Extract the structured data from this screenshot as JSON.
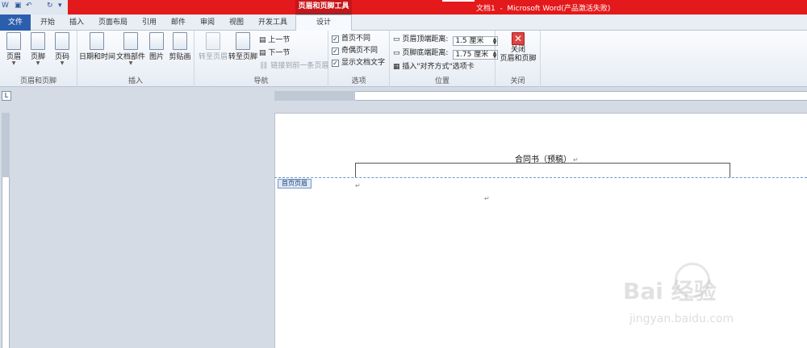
{
  "titlebar": {
    "app_title": "文档1  -  Microsoft Word(产品激活失败)",
    "context_tool_title": "页眉和页脚工具",
    "quick_access": [
      "save-icon",
      "undo-icon",
      "redo-icon",
      "customize-icon"
    ]
  },
  "tabs": [
    {
      "label": "文件"
    },
    {
      "label": "开始"
    },
    {
      "label": "插入"
    },
    {
      "label": "页面布局"
    },
    {
      "label": "引用"
    },
    {
      "label": "邮件"
    },
    {
      "label": "审阅"
    },
    {
      "label": "视图"
    },
    {
      "label": "开发工具"
    },
    {
      "label": "设计"
    }
  ],
  "ribbon": {
    "header_footer_group": {
      "label": "页眉和页脚",
      "header": "页眉",
      "footer": "页脚",
      "page_number": "页码"
    },
    "insert_group": {
      "label": "插入",
      "datetime": "日期和时间",
      "doc_parts": "文档部件",
      "picture": "图片",
      "clipart": "剪贴画"
    },
    "nav_group": {
      "label": "导航",
      "goto_header": "转至页眉",
      "goto_footer": "转至页脚",
      "prev": "上一节",
      "next": "下一节",
      "link_prev": "链接到前一条页眉"
    },
    "options_group": {
      "label": "选项",
      "diff_first": "首页不同",
      "diff_odd_even": "奇偶页不同",
      "show_text": "显示文档文字"
    },
    "position_group": {
      "label": "位置",
      "header_top_label": "页眉顶端距离:",
      "header_top_value": "1.5 厘米",
      "footer_bottom_label": "页脚底端距离:",
      "footer_bottom_value": "1.75 厘米",
      "insert_align_tab": "插入\"对齐方式\"选项卡"
    },
    "close_group": {
      "label": "关闭",
      "close_button": "关闭\n页眉和页脚"
    }
  },
  "document": {
    "header_tag": "首页页眉",
    "heading": "合同书（预稿）",
    "pilcrow": "↵"
  },
  "watermark": {
    "brand": "Bai 经验",
    "url": "jingyan.baidu.com"
  }
}
